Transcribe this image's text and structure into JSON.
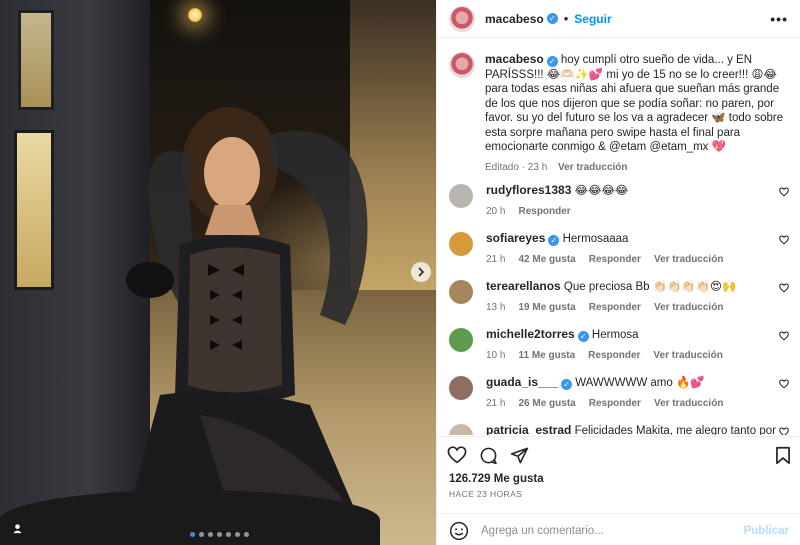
{
  "post": {
    "username": "macabeso",
    "follow_label": "Seguir",
    "more_label": "•••",
    "separator": "•",
    "caption": "hoy cumplí otro sueño de vida... y EN PARÍSSS!!! 😂🫶🏻✨💕 mi yo de 15 no se lo creer!!! 😩😂 para todas esas niñas ahi afuera que sueñan más grande de los que nos dijeron que se podía soñar: no paren, por favor. su yo del futuro se los va a agradecer 🦋 todo sobre esta sorpre mañana pero swipe hasta el final para emocionarte conmigo & @etam @etam_mx 💖",
    "caption_meta": "Editado · 23 h",
    "caption_translate": "Ver traducción",
    "likes": "126.729 Me gusta",
    "time_ago": "HACE 23 HORAS",
    "comment_placeholder": "Agrega un comentario...",
    "publish_label": "Publicar"
  },
  "comments": [
    {
      "user": "rudyflores1383",
      "verified": false,
      "text": "😂😂😂😂",
      "time": "20 h",
      "likes": "",
      "reply": "Responder",
      "translate": "",
      "avatar_color": "#b9b4ae"
    },
    {
      "user": "sofiareyes",
      "verified": true,
      "text": "Hermosaaaa",
      "time": "21 h",
      "likes": "42 Me gusta",
      "reply": "Responder",
      "translate": "Ver traducción",
      "avatar_color": "#d79a3a"
    },
    {
      "user": "terearellanos",
      "verified": false,
      "text": "Que preciosa Bb 👏🏻👏🏻👏🏻👏🏻😍🙌",
      "time": "13 h",
      "likes": "19 Me gusta",
      "reply": "Responder",
      "translate": "Ver traducción",
      "avatar_color": "#a8865d"
    },
    {
      "user": "michelle2torres",
      "verified": true,
      "text": "Hermosa",
      "time": "10 h",
      "likes": "11 Me gusta",
      "reply": "Responder",
      "translate": "Ver traducción",
      "avatar_color": "#5d9b4f"
    },
    {
      "user": "guada_is___",
      "verified": true,
      "text": "WAWWWWW amo 🔥💕",
      "time": "21 h",
      "likes": "26 Me gusta",
      "reply": "Responder",
      "translate": "Ver traducción",
      "avatar_color": "#8f6f62"
    },
    {
      "user": "patricia_estrad",
      "verified": false,
      "text": "Felicidades Makita, me alegro tanto por ti, y",
      "time": "",
      "likes": "",
      "reply": "",
      "translate": "",
      "avatar_color": "#c9b8a6"
    }
  ],
  "carousel": {
    "count": 7,
    "active": 0
  },
  "colors": {
    "accent": "#0095f6",
    "verified": "#3897f0",
    "muted": "#737373"
  }
}
